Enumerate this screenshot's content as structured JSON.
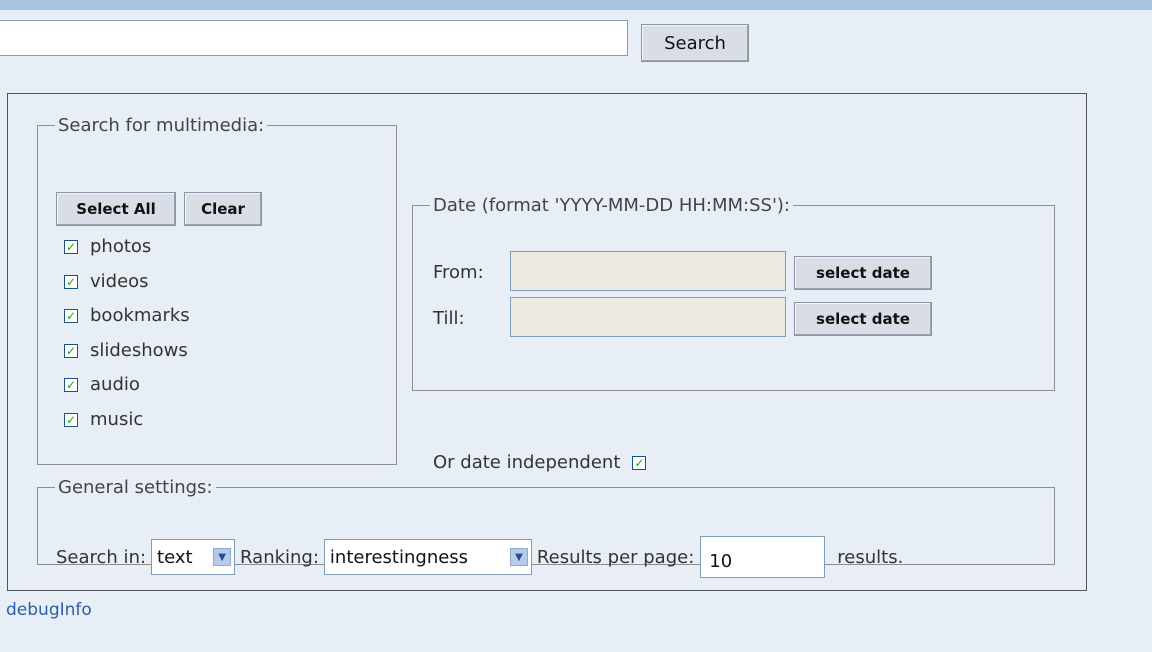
{
  "search": {
    "value": "",
    "button_label": "Search"
  },
  "media": {
    "legend": "Search for multimedia:",
    "select_all_label": "Select All",
    "clear_label": "Clear",
    "items": [
      {
        "label": "photos",
        "checked": true
      },
      {
        "label": "videos",
        "checked": true
      },
      {
        "label": "bookmarks",
        "checked": true
      },
      {
        "label": "slideshows",
        "checked": true
      },
      {
        "label": "audio",
        "checked": true
      },
      {
        "label": "music",
        "checked": true
      }
    ]
  },
  "date": {
    "legend": "Date (format 'YYYY-MM-DD HH:MM:SS'):",
    "from_label": "From:",
    "till_label": "Till:",
    "from_value": "",
    "till_value": "",
    "select_date_label": "select date",
    "independent_label": "Or date independent",
    "independent_checked": true
  },
  "general": {
    "legend": "General settings:",
    "search_in_label": "Search in:",
    "search_in_value": "text",
    "ranking_label": "Ranking:",
    "ranking_value": "interestingness",
    "results_label": "Results per page:",
    "results_value": "10",
    "results_suffix": "results."
  },
  "debug_link": "debugInfo",
  "colors": {
    "background": "#e8eef6",
    "top_bar": "#a9c3e0",
    "link": "#2d5fa8",
    "check": "#21a121"
  }
}
